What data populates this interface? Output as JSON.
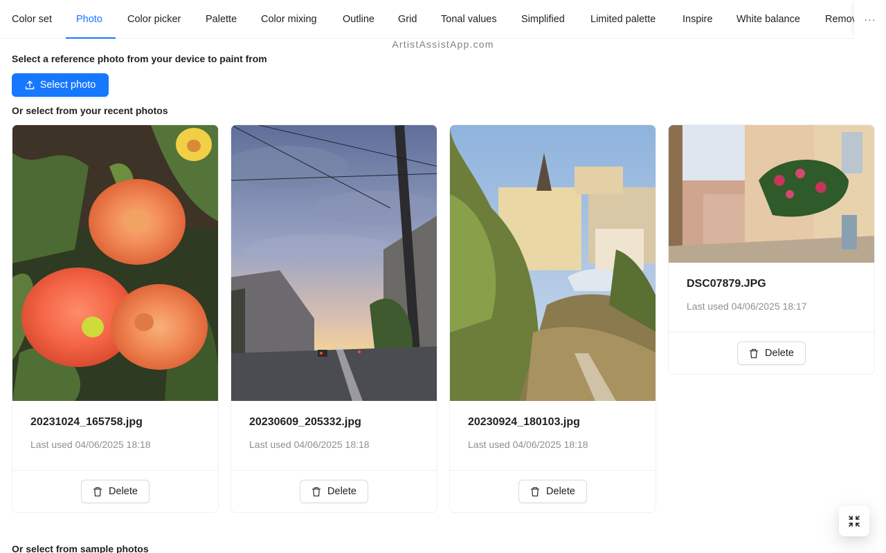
{
  "tabs": [
    {
      "label": "Color set",
      "active": false
    },
    {
      "label": "Photo",
      "active": true
    },
    {
      "label": "Color picker",
      "active": false
    },
    {
      "label": "Palette",
      "active": false
    },
    {
      "label": "Color mixing",
      "active": false
    },
    {
      "label": "Outline",
      "active": false
    },
    {
      "label": "Grid",
      "active": false
    },
    {
      "label": "Tonal values",
      "active": false
    },
    {
      "label": "Simplified",
      "active": false
    },
    {
      "label": "Limited palette",
      "active": false
    },
    {
      "label": "Inspire",
      "active": false
    },
    {
      "label": "White balance",
      "active": false
    },
    {
      "label": "Remov",
      "active": false
    }
  ],
  "more_button": {
    "icon": "ellipsis-icon",
    "label": "···"
  },
  "watermark": "ArtistAssistApp.com",
  "intro": {
    "heading": "Select a reference photo from your device to paint from",
    "select_button": {
      "label": "Select photo",
      "icon": "upload-icon"
    }
  },
  "recent": {
    "heading": "Or select from your recent photos",
    "photos": [
      {
        "name": "20231024_165758.jpg",
        "last_used": "Last used 04/06/2025 18:18",
        "delete_label": "Delete",
        "subject": "orange dahlias"
      },
      {
        "name": "20230609_205332.jpg",
        "last_used": "Last used 04/06/2025 18:18",
        "delete_label": "Delete",
        "subject": "city street at dusk"
      },
      {
        "name": "20230924_180103.jpg",
        "last_used": "Last used 04/06/2025 18:18",
        "delete_label": "Delete",
        "subject": "old town view from hill"
      },
      {
        "name": "DSC07879.JPG",
        "last_used": "Last used 04/06/2025 18:17",
        "delete_label": "Delete",
        "subject": "street with flowering balcony"
      }
    ]
  },
  "samples": {
    "heading": "Or select from sample photos"
  },
  "colors": {
    "accent": "#1677ff",
    "border": "#f0f0f0",
    "muted_text": "rgba(0,0,0,0.45)"
  },
  "fullscreen_button": {
    "icon": "exit-fullscreen-icon"
  }
}
